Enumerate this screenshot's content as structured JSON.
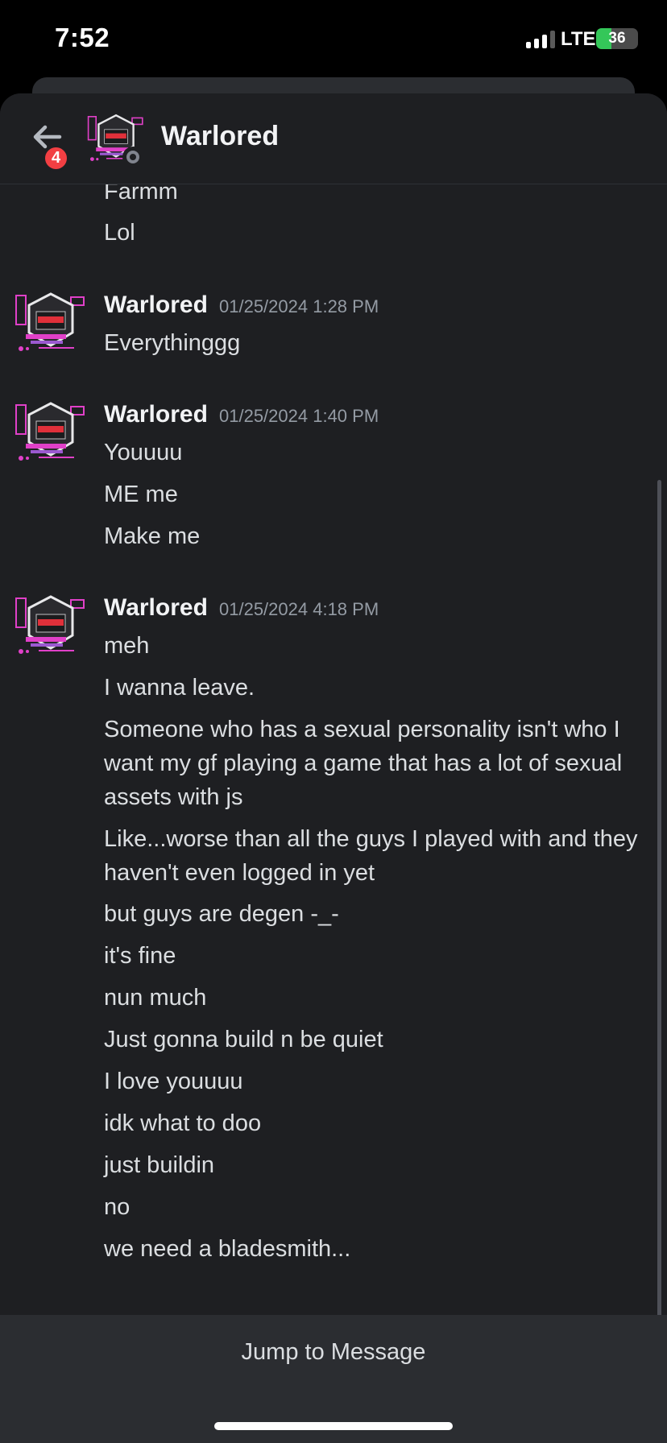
{
  "status_bar": {
    "time": "7:52",
    "network": "LTE",
    "battery": "36",
    "battery_level": 0.36
  },
  "header": {
    "back_icon": "arrow-left-icon",
    "unread_badge": "4",
    "channel_title": "Warlored",
    "presence": "offline"
  },
  "messages": {
    "partial_lines": [
      "Farmm",
      "Lol"
    ],
    "groups": [
      {
        "author": "Warlored",
        "timestamp": "01/25/2024 1:28 PM",
        "lines": [
          "Everythinggg"
        ]
      },
      {
        "author": "Warlored",
        "timestamp": "01/25/2024 1:40 PM",
        "lines": [
          "Youuuu",
          "ME me",
          "Make me"
        ]
      },
      {
        "author": "Warlored",
        "timestamp": "01/25/2024 4:18 PM",
        "lines": [
          "meh",
          "I wanna leave.",
          "Someone who has a sexual personality isn't who I want my gf playing a game that has a lot of sexual assets with js",
          "Like...worse than all the guys I played with and they haven't even logged in yet",
          "but guys are degen -_-",
          "it's fine",
          "nun much",
          "Just gonna build n be quiet",
          "I love youuuu",
          "idk what to doo",
          "just buildin",
          "no",
          "we need a bladesmith..."
        ]
      }
    ]
  },
  "footer": {
    "jump_label": "Jump to Message"
  },
  "colors": {
    "background": "#1e1f22",
    "badge": "#f23f43",
    "battery_fill": "#34c759",
    "avatar_pink": "#e040c8",
    "avatar_red": "#e0303a"
  }
}
